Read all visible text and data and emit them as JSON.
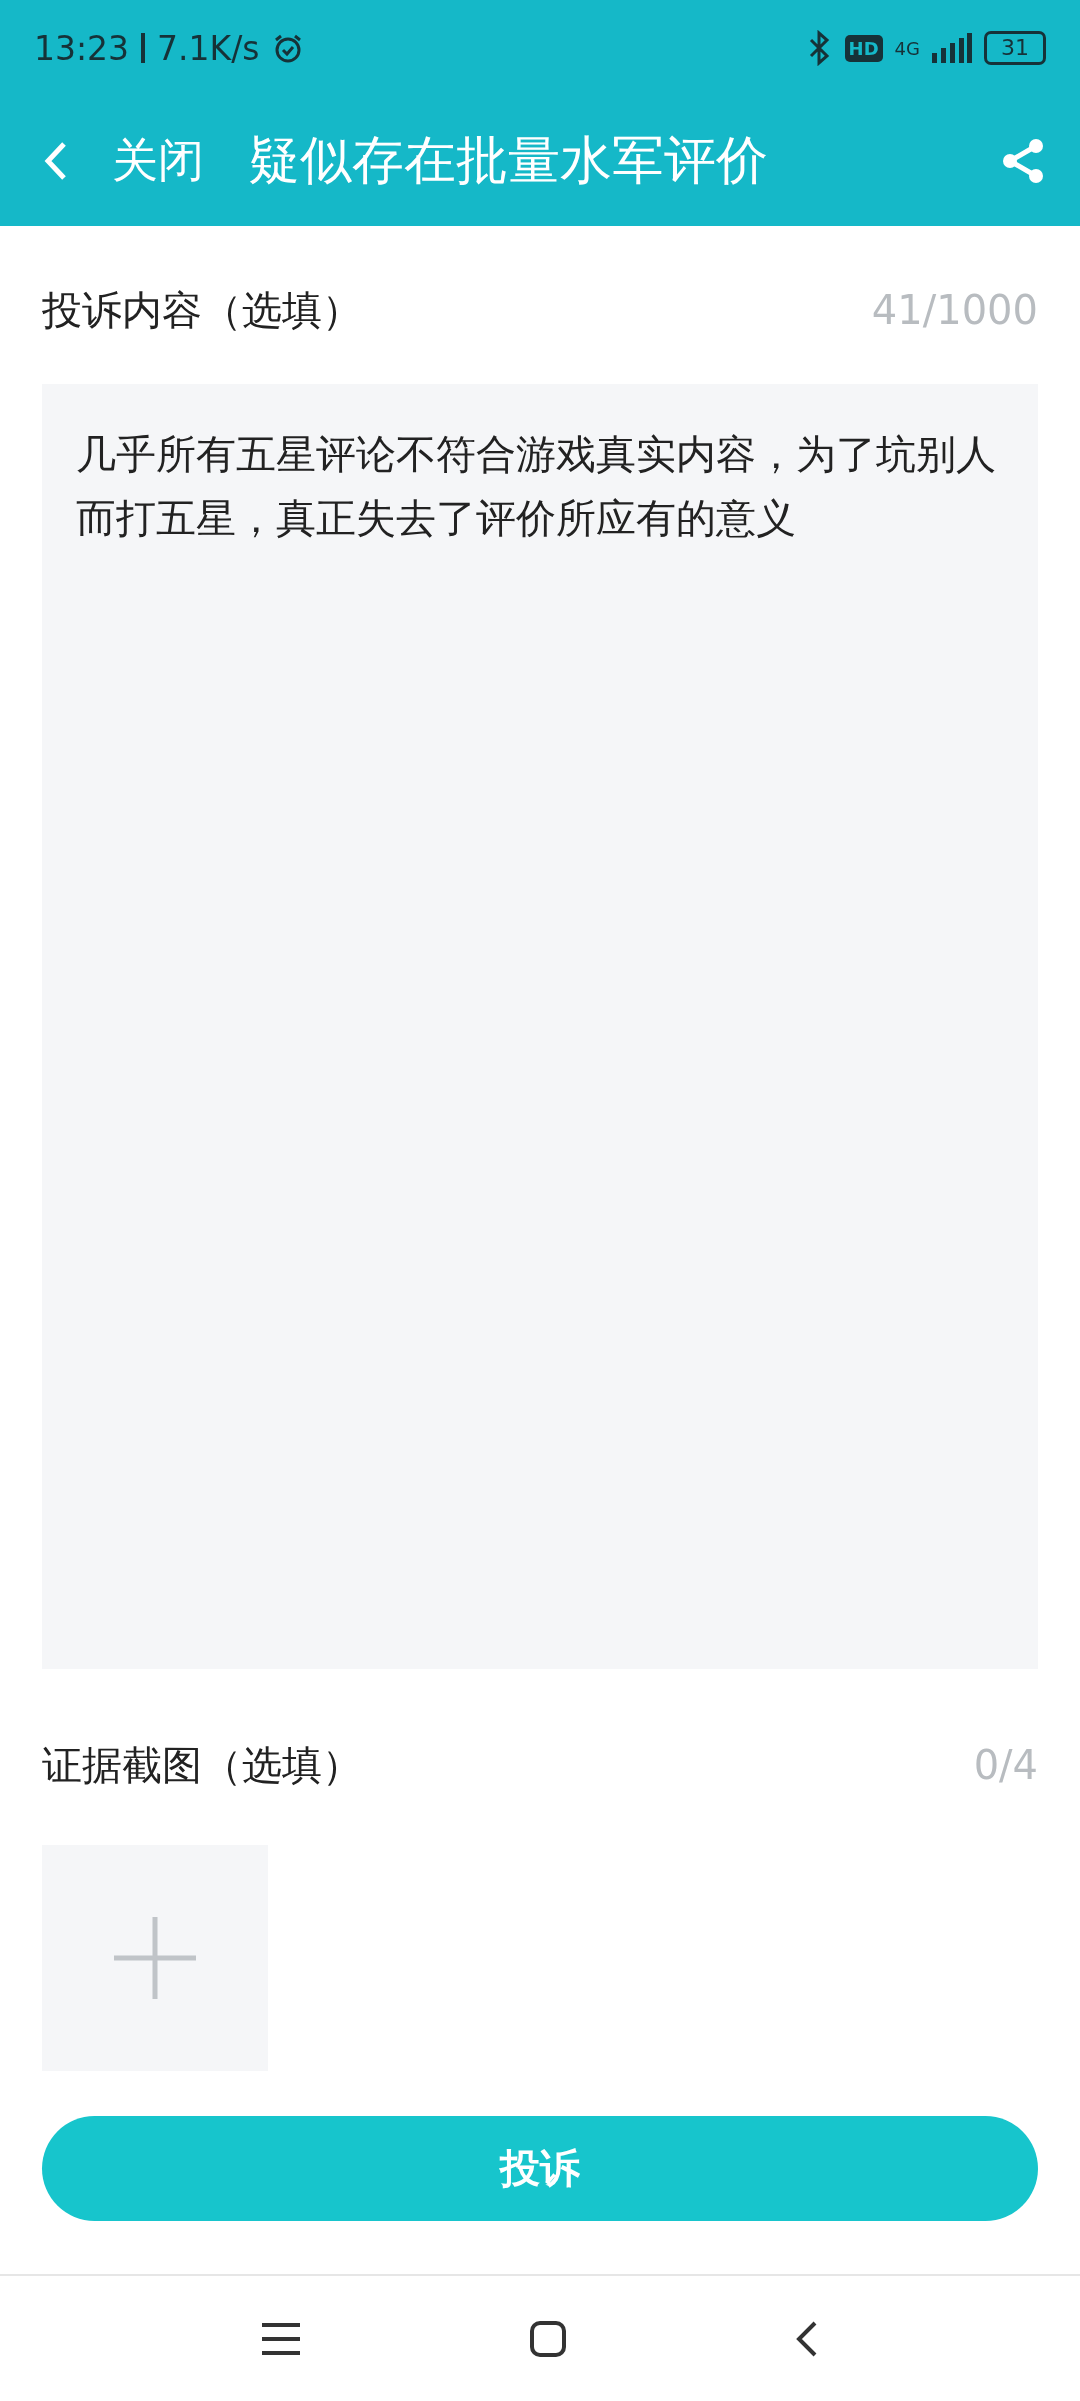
{
  "status_bar": {
    "time": "13:23",
    "speed": "7.1K/s",
    "network": "4G",
    "hd": "HD",
    "battery": "31"
  },
  "header": {
    "close": "关闭",
    "title": "疑似存在批量水军评价"
  },
  "content": {
    "label": "投诉内容（选填）",
    "counter": "41/1000",
    "value": "几乎所有五星评论不符合游戏真实内容，为了坑别人而打五星，真正失去了评价所应有的意义"
  },
  "screenshots": {
    "label": "证据截图（选填）",
    "counter": "0/4"
  },
  "submit": "投诉"
}
